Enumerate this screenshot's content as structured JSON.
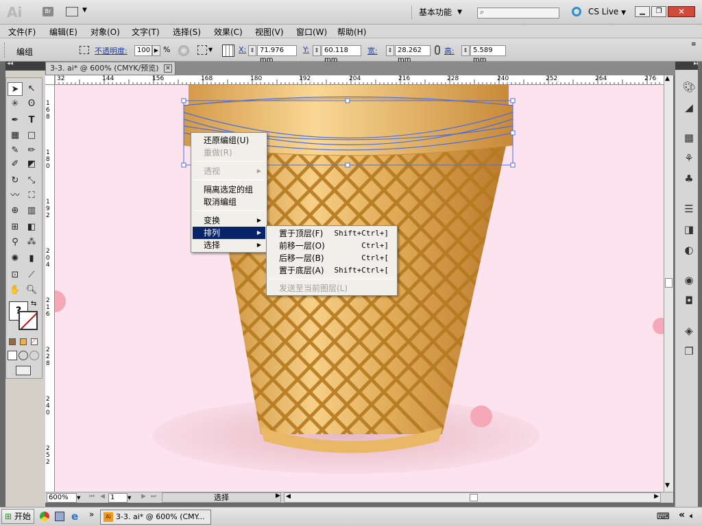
{
  "app": {
    "logo": "Ai",
    "bridge": "Br",
    "workspace": "基本功能",
    "search_placeholder": "",
    "cslive": "CS Live",
    "colors": {
      "accent": "#0a246a",
      "canvas_bg": "#fde3ee",
      "cone": "#d8a84e"
    }
  },
  "menu": [
    "文件(F)",
    "编辑(E)",
    "对象(O)",
    "文字(T)",
    "选择(S)",
    "效果(C)",
    "视图(V)",
    "窗口(W)",
    "帮助(H)"
  ],
  "control": {
    "selection_label": "编组",
    "opacity_label": "不透明度:",
    "opacity_value": "100",
    "opacity_unit": "%",
    "x_label": "X:",
    "x_value": "71.976 mm",
    "y_label": "Y:",
    "y_value": "60.118 mm",
    "w_label": "宽:",
    "w_value": "28.262 mm",
    "h_label": "高:",
    "h_value": "5.589 mm"
  },
  "document": {
    "tab_title": "3-3. ai* @ 600% (CMYK/预览)",
    "h_ruler_ticks": [
      "32",
      "144",
      "156",
      "168",
      "180",
      "192",
      "204",
      "216",
      "228",
      "240",
      "252",
      "264",
      "276"
    ],
    "v_ruler_ticks": [
      "168",
      "180",
      "192",
      "204",
      "216",
      "228",
      "240",
      "252"
    ]
  },
  "context_menu": {
    "items": [
      {
        "label": "还原编组(U)",
        "disabled": false
      },
      {
        "label": "重做(R)",
        "disabled": true
      },
      {
        "label": "透视",
        "disabled": true,
        "submenu": true
      },
      {
        "label": "隔离选定的组",
        "disabled": false
      },
      {
        "label": "取消编组",
        "disabled": false
      },
      {
        "label": "变换",
        "disabled": false,
        "submenu": true
      },
      {
        "label": "排列",
        "disabled": false,
        "submenu": true,
        "highlighted": true
      },
      {
        "label": "选择",
        "disabled": false,
        "submenu": true
      }
    ]
  },
  "submenu": {
    "items": [
      {
        "label": "置于顶层(F)",
        "shortcut": "Shift+Ctrl+]"
      },
      {
        "label": "前移一层(O)",
        "shortcut": "Ctrl+]"
      },
      {
        "label": "后移一层(B)",
        "shortcut": "Ctrl+["
      },
      {
        "label": "置于底层(A)",
        "shortcut": "Shift+Ctrl+["
      },
      {
        "label": "发送至当前图层(L)",
        "shortcut": "",
        "disabled": true
      }
    ]
  },
  "status": {
    "zoom": "600%",
    "page": "1",
    "tool": "选择"
  },
  "taskbar": {
    "start": "开始",
    "task": "3-3. ai* @ 600% (CMY..."
  }
}
